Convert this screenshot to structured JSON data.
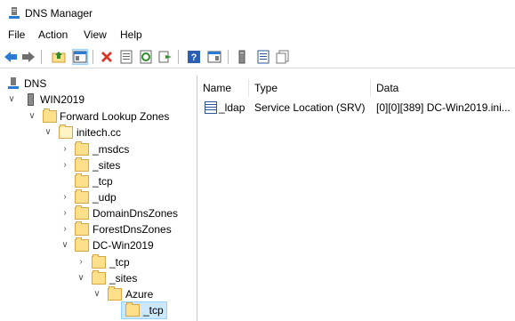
{
  "window": {
    "title": "DNS Manager"
  },
  "menu": {
    "items": [
      "File",
      "Action",
      "View",
      "Help"
    ]
  },
  "toolbar": {
    "icons": [
      "back-arrow-icon",
      "forward-arrow-icon",
      "up-folder-icon",
      "show-hide-tree-icon",
      "delete-icon",
      "properties-icon",
      "refresh-icon",
      "export-list-icon",
      "help-icon",
      "console-pane-icon",
      "new-record-icon",
      "new-domain-icon",
      "new-delegation-icon"
    ]
  },
  "tree": {
    "root": "DNS",
    "server": "WIN2019",
    "flz": "Forward Lookup Zones",
    "zone": "initech.cc",
    "msdcs": "_msdcs",
    "sites": "_sites",
    "tcp": "_tcp",
    "udp": "_udp",
    "domaindnszones": "DomainDnsZones",
    "forestdnszones": "ForestDnsZones",
    "dc": "DC-Win2019",
    "dc_tcp": "_tcp",
    "dc_sites": "_sites",
    "azure": "Azure",
    "azure_tcp": "_tcp"
  },
  "details": {
    "columns": {
      "name": "Name",
      "type": "Type",
      "data": "Data"
    },
    "rows": [
      {
        "name": "_ldap",
        "type": "Service Location (SRV)",
        "data": "[0][0][389] DC-Win2019.ini..."
      }
    ]
  },
  "colors": {
    "selection": "#cce8ff",
    "folder": "#ffe08a",
    "back_arrow": "#2a7bd4"
  }
}
